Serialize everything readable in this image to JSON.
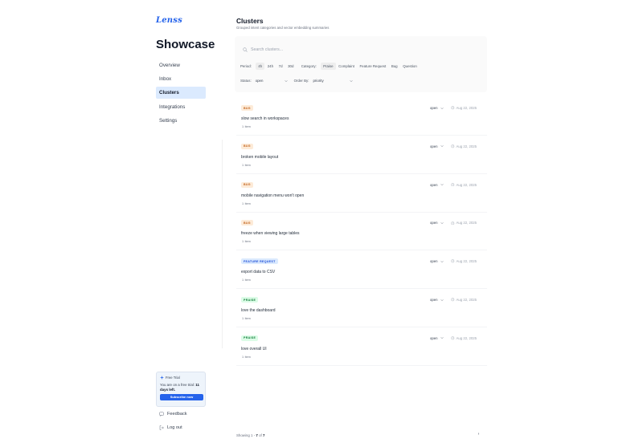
{
  "sidebar": {
    "logo": "Lenss",
    "title": "Showcase",
    "nav": [
      {
        "label": "Overview",
        "active": false
      },
      {
        "label": "Inbox",
        "active": false
      },
      {
        "label": "Clusters",
        "active": true
      },
      {
        "label": "Integrations",
        "active": false
      },
      {
        "label": "Settings",
        "active": false
      }
    ],
    "trial": {
      "heading": "Free Trial",
      "text_prefix": "You are on a free trial: ",
      "text_bold": "11 days left.",
      "button": "Subscribe now"
    },
    "feedback": "Feedback",
    "logout": "Log out"
  },
  "main": {
    "title": "Clusters",
    "subtitle": "Grouped intent categories and vector embedding summaries",
    "search_placeholder": "Search clusters...",
    "period_label": "Period:",
    "periods": [
      {
        "label": "4h",
        "selected": true
      },
      {
        "label": "24h",
        "selected": false
      },
      {
        "label": "7d",
        "selected": false
      },
      {
        "label": "30d",
        "selected": false
      }
    ],
    "category_label": "Category:",
    "categories": [
      {
        "label": "Praise",
        "selected": true
      },
      {
        "label": "Complaint",
        "selected": false
      },
      {
        "label": "Feature Request",
        "selected": false
      },
      {
        "label": "Bug",
        "selected": false
      },
      {
        "label": "Question",
        "selected": false
      }
    ],
    "status_label": "Status:",
    "status_value": "open",
    "order_label": "Order By:",
    "order_value": "priority",
    "clusters": [
      {
        "tag": "bug",
        "tag_label": "BUG",
        "title": "slow search in workspaces",
        "count": "1",
        "unit": "item",
        "status": "open",
        "date": "Aug 22, 2025"
      },
      {
        "tag": "bug",
        "tag_label": "BUG",
        "title": "broken mobile layout",
        "count": "1",
        "unit": "item",
        "status": "open",
        "date": "Aug 22, 2025"
      },
      {
        "tag": "bug",
        "tag_label": "BUG",
        "title": "mobile navigation menu won't open",
        "count": "1",
        "unit": "item",
        "status": "open",
        "date": "Aug 22, 2025"
      },
      {
        "tag": "bug",
        "tag_label": "BUG",
        "title": "freeze when viewing large tables",
        "count": "1",
        "unit": "item",
        "status": "open",
        "date": "Aug 22, 2025"
      },
      {
        "tag": "feature",
        "tag_label": "FEATURE REQUEST",
        "title": "export data to CSV",
        "count": "1",
        "unit": "item",
        "status": "open",
        "date": "Aug 22, 2025"
      },
      {
        "tag": "praise",
        "tag_label": "PRAISE",
        "title": "love the dashboard",
        "count": "1",
        "unit": "item",
        "status": "open",
        "date": "Aug 22, 2025"
      },
      {
        "tag": "praise",
        "tag_label": "PRAISE",
        "title": "love overall UI",
        "count": "1",
        "unit": "item",
        "status": "open",
        "date": "Aug 22, 2025"
      }
    ],
    "pager_prefix": "Showing 1 - ",
    "pager_to": "7",
    "pager_of": " of ",
    "pager_total": "7",
    "pager_next": "›"
  }
}
